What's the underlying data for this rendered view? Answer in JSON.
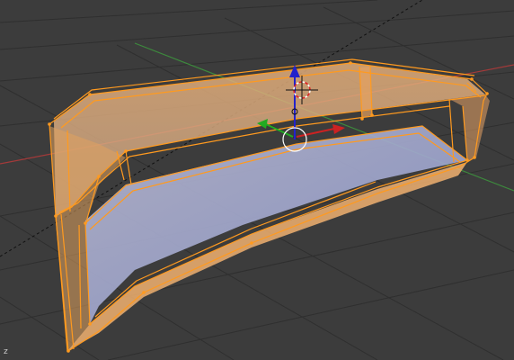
{
  "viewport": {
    "background_color": "#3c3c3c",
    "grid_color": "#2e2e2e",
    "x_axis_color": "#a33a3a",
    "y_axis_color": "#3d8a3d",
    "view_axis_label": "z"
  },
  "selection": {
    "wire_color": "#ff9a1f",
    "fill_color": "#e3a05a",
    "inner_shade_color": "#9aa7d1"
  },
  "manipulator": {
    "x_arrow_color": "#cc2222",
    "y_arrow_color": "#22aa22",
    "z_arrow_color": "#2222cc",
    "cursor_icon": "3d-cursor-icon",
    "pivot_icon": "pivot-circle-icon"
  }
}
